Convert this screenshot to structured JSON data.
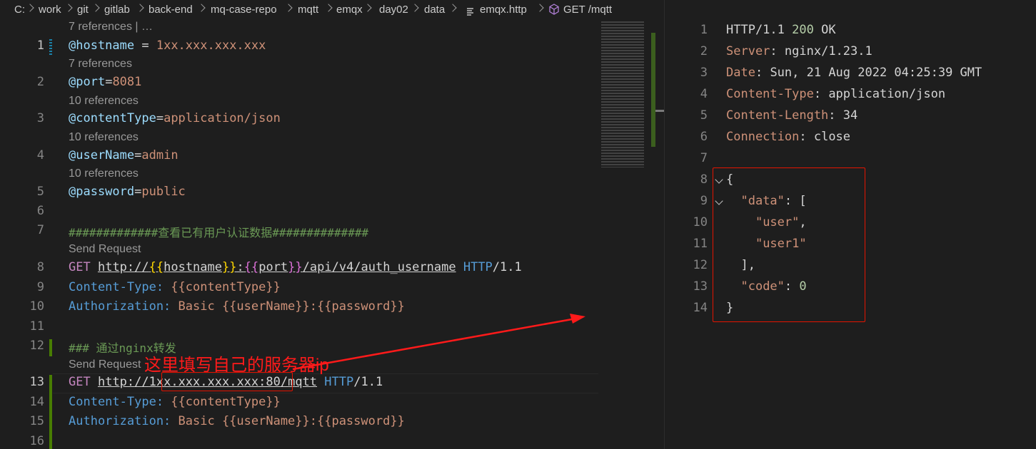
{
  "breadcrumb": [
    "C:",
    "work",
    "git",
    "gitlab",
    "back-end",
    "mq-case-repo",
    "mqtt",
    "emqx",
    "day02",
    "data",
    "emqx.http",
    "GET /mqtt"
  ],
  "editor": {
    "lens": {
      "l1": "7 references | …",
      "l2": "7 references",
      "l3": "10 references",
      "l4": "10 references",
      "l5": "10 references",
      "send1": "Send Request",
      "send2": "Send Request"
    },
    "line_numbers": [
      "1",
      "2",
      "3",
      "4",
      "5",
      "6",
      "7",
      "8",
      "9",
      "10",
      "11",
      "12",
      "13",
      "14",
      "15",
      "16"
    ],
    "l1": {
      "var": "@hostname",
      "op": " = ",
      "val": "1xx.xxx.xxx.xxx"
    },
    "l2": {
      "var": "@port",
      "op": "=",
      "val": "8081"
    },
    "l3": {
      "var": "@contentType",
      "op": "=",
      "val": "application/json"
    },
    "l4": {
      "var": "@userName",
      "op": "=",
      "val": "admin"
    },
    "l5": {
      "var": "@password",
      "op": "=",
      "val": "public"
    },
    "l7": "#############查看已有用户认证数据##############",
    "l8": {
      "method": "GET",
      "url_prefix": "http://",
      "b1": "{{",
      "v1": "hostname",
      "b2": "}}",
      "colon": ":",
      "b3": "{{",
      "v2": "port",
      "b4": "}}",
      "path": "/api/v4/auth_username",
      "http": "HTTP",
      "ver": "/1.1"
    },
    "l9": {
      "key": "Content-Type:",
      "val": " {{contentType}}"
    },
    "l10": {
      "key": "Authorization:",
      "val": " Basic {{userName}}:{{password}}"
    },
    "l12": "### 通过nginx转发",
    "l13": {
      "method": "GET",
      "url_prefix": "http://",
      "host": "1xx.xxx.xxx.xxx",
      "rest": ":80/mqtt",
      "http": "HTTP",
      "ver": "/1.1"
    },
    "l14": {
      "key": "Content-Type:",
      "val": " {{contentType}}"
    },
    "l15": {
      "key": "Authorization:",
      "val": " Basic {{userName}}:{{password}}"
    }
  },
  "annotation": "这里填写自己的服务器ip",
  "response": {
    "line_numbers": [
      "1",
      "2",
      "3",
      "4",
      "5",
      "6",
      "7",
      "8",
      "9",
      "10",
      "11",
      "12",
      "13",
      "14"
    ],
    "status": {
      "proto": "HTTP/1.1 ",
      "code": "200",
      "text": " OK"
    },
    "headers": [
      {
        "k": "Server",
        "v": "nginx/1.23.1"
      },
      {
        "k": "Date",
        "v": "Sun, 21 Aug 2022 04:25:39 GMT"
      },
      {
        "k": "Content-Type",
        "v": "application/json"
      },
      {
        "k": "Content-Length",
        "v": "34"
      },
      {
        "k": "Connection",
        "v": "close"
      }
    ],
    "body": {
      "open": "{",
      "data_key": "\"data\"",
      "data_open": ": [",
      "user": "\"user\"",
      "user_comma": ",",
      "user1": "\"user1\"",
      "data_close": "],",
      "code_key": "\"code\"",
      "code_colon": ": ",
      "code_val": "0",
      "close": "}"
    }
  }
}
